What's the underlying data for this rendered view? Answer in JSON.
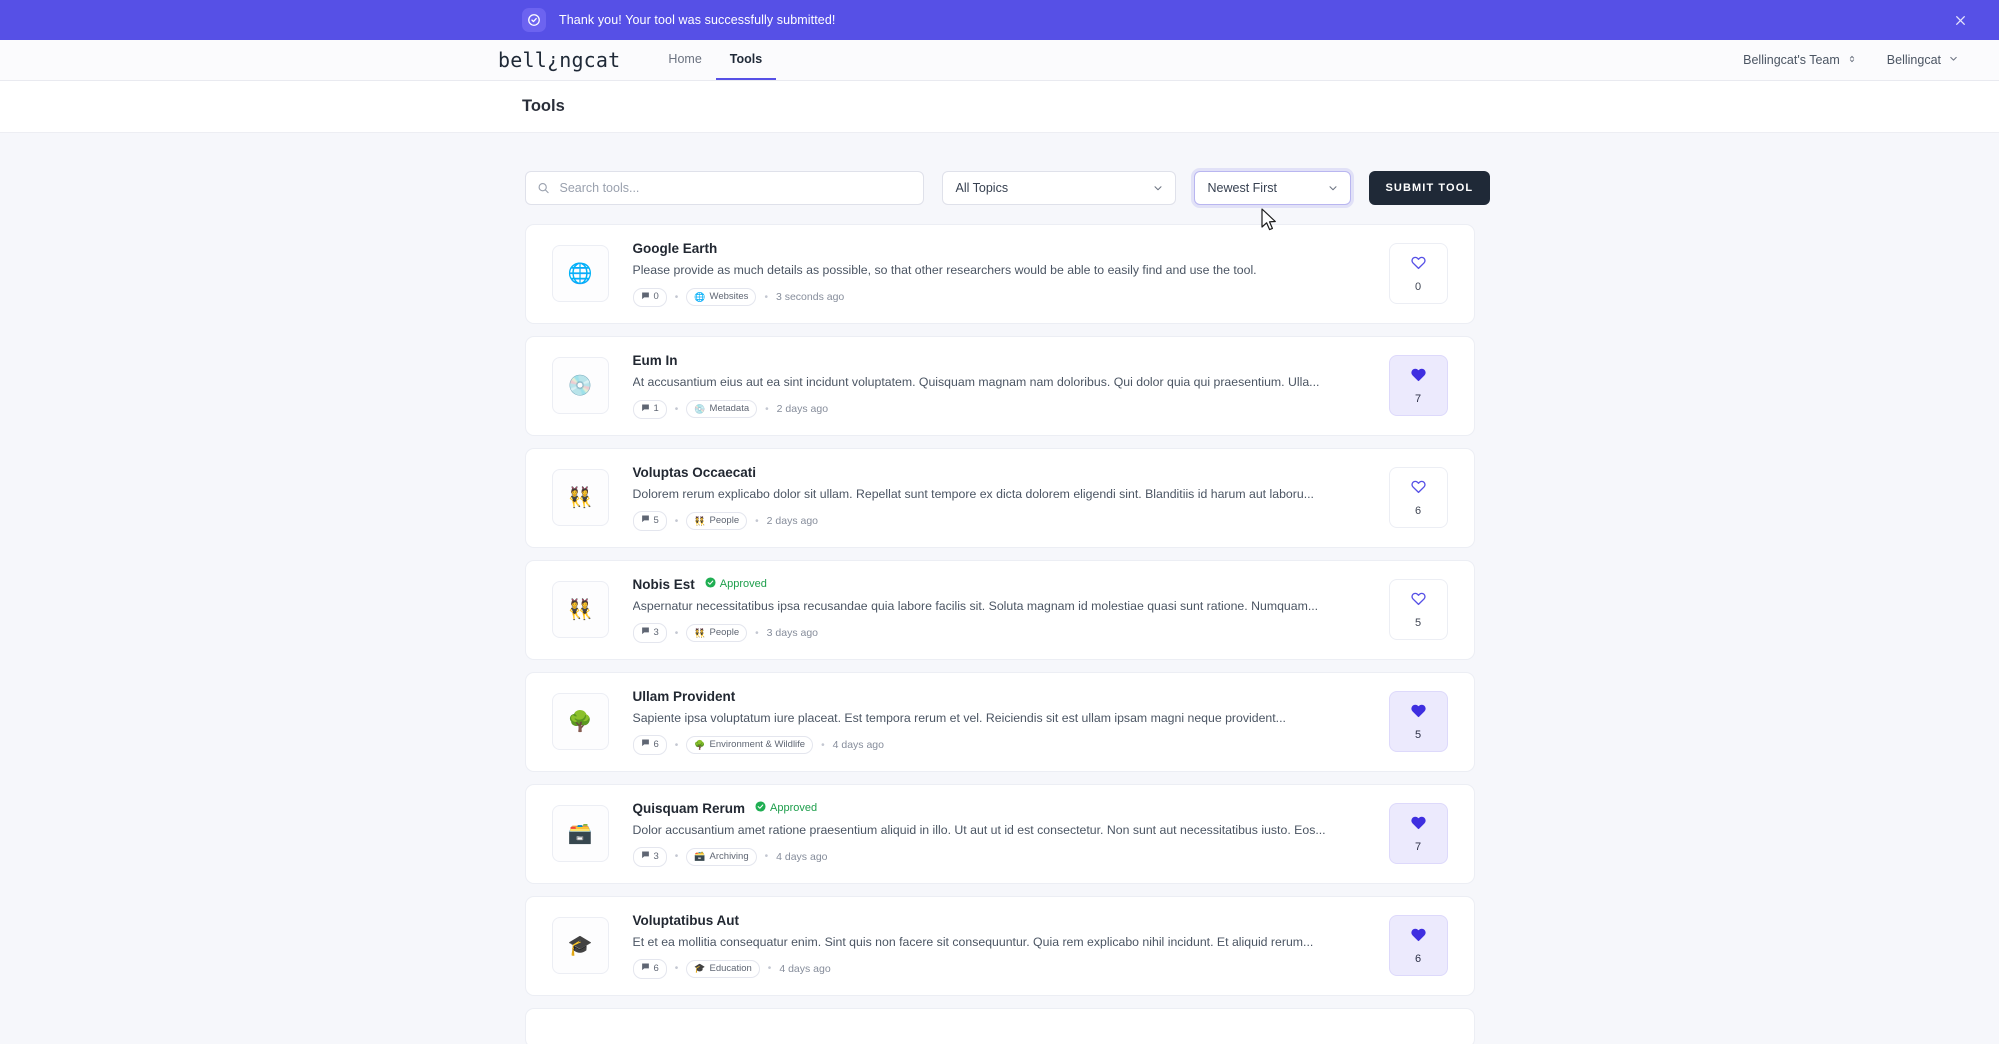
{
  "banner": {
    "message": "Thank you! Your tool was successfully submitted!",
    "icon": "check-circle-icon",
    "close_icon": "close-icon",
    "background": "#5650e6"
  },
  "navbar": {
    "logo": "bell¿ngcat",
    "links": [
      {
        "label": "Home",
        "active": false
      },
      {
        "label": "Tools",
        "active": true
      }
    ],
    "team_selector": "Bellingcat's Team",
    "user_menu": "Bellingcat"
  },
  "page": {
    "title": "Tools"
  },
  "filters": {
    "search_placeholder": "Search tools...",
    "search_value": "",
    "topic_selected": "All Topics",
    "sort_selected": "Newest First",
    "submit_label": "SUBMIT TOOL",
    "submit_color": "#1f2937"
  },
  "tools": [
    {
      "thumb": "🌐",
      "title": "Google Earth",
      "approved": false,
      "approved_label": "",
      "description": "Please provide as much details as possible, so that other researchers would be able to easily find and use the tool.",
      "comments": "0",
      "topic_emoji": "🌐",
      "topic": "Websites",
      "time": "3 seconds ago",
      "likes": "0",
      "liked": false
    },
    {
      "thumb": "💿",
      "title": "Eum In",
      "approved": false,
      "approved_label": "",
      "description": "At accusantium eius aut ea sint incidunt voluptatem. Quisquam magnam nam doloribus. Qui dolor quia qui praesentium. Ulla...",
      "comments": "1",
      "topic_emoji": "💿",
      "topic": "Metadata",
      "time": "2 days ago",
      "likes": "7",
      "liked": true
    },
    {
      "thumb": "👯",
      "title": "Voluptas Occaecati",
      "approved": false,
      "approved_label": "",
      "description": "Dolorem rerum explicabo dolor sit ullam. Repellat sunt tempore ex dicta dolorem eligendi sint. Blanditiis id harum aut laboru...",
      "comments": "5",
      "topic_emoji": "👯",
      "topic": "People",
      "time": "2 days ago",
      "likes": "6",
      "liked": false
    },
    {
      "thumb": "👯",
      "title": "Nobis Est",
      "approved": true,
      "approved_label": "Approved",
      "description": "Aspernatur necessitatibus ipsa recusandae quia labore facilis sit. Soluta magnam id molestiae quasi sunt ratione. Numquam...",
      "comments": "3",
      "topic_emoji": "👯",
      "topic": "People",
      "time": "3 days ago",
      "likes": "5",
      "liked": false
    },
    {
      "thumb": "🌳",
      "title": "Ullam Provident",
      "approved": false,
      "approved_label": "",
      "description": "Sapiente ipsa voluptatum iure placeat. Est tempora rerum et vel. Reiciendis sit est ullam ipsam magni neque provident...",
      "comments": "6",
      "topic_emoji": "🌳",
      "topic": "Environment & Wildlife",
      "time": "4 days ago",
      "likes": "5",
      "liked": true
    },
    {
      "thumb": "🗃️",
      "title": "Quisquam Rerum",
      "approved": true,
      "approved_label": "Approved",
      "description": "Dolor accusantium amet ratione praesentium aliquid in illo. Ut aut ut id est consectetur. Non sunt aut necessitatibus iusto. Eos...",
      "comments": "3",
      "topic_emoji": "🗃️",
      "topic": "Archiving",
      "time": "4 days ago",
      "likes": "7",
      "liked": true
    },
    {
      "thumb": "🎓",
      "title": "Voluptatibus Aut",
      "approved": false,
      "approved_label": "",
      "description": "Et et ea mollitia consequatur enim. Sint quis non facere sit consequuntur. Quia rem explicabo nihil incidunt. Et aliquid rerum...",
      "comments": "6",
      "topic_emoji": "🎓",
      "topic": "Education",
      "time": "4 days ago",
      "likes": "6",
      "liked": true
    },
    {
      "thumb": "",
      "title": "",
      "approved": false,
      "approved_label": "",
      "description": "",
      "comments": "",
      "topic_emoji": "",
      "topic": "",
      "time": "",
      "likes": "",
      "liked": false,
      "partial": true
    }
  ]
}
